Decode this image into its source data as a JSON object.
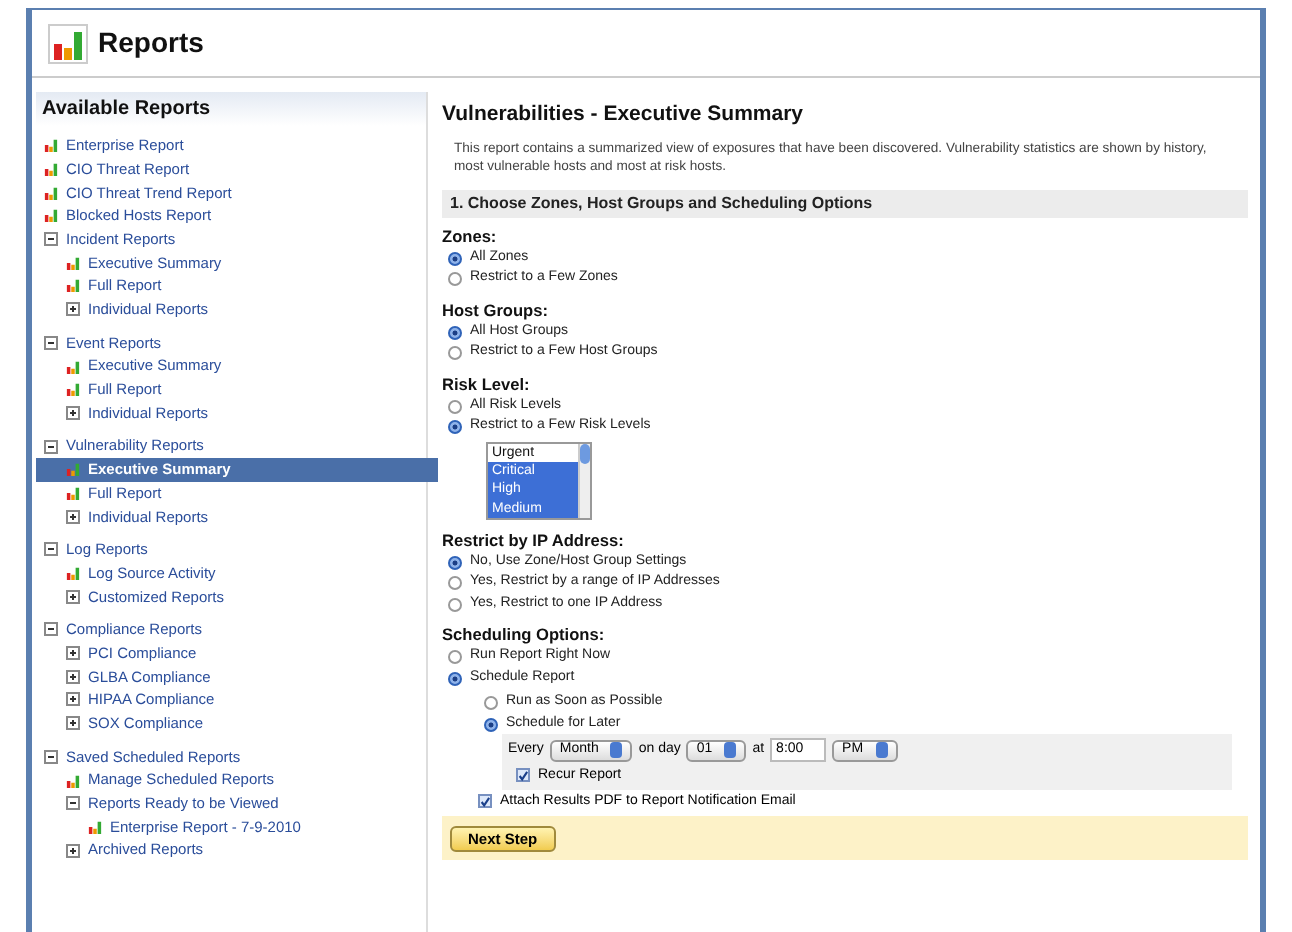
{
  "header": {
    "title": "Reports"
  },
  "sidebar": {
    "title": "Available Reports",
    "items": [
      {
        "label": "Enterprise Report",
        "kind": "report",
        "selected": false
      },
      {
        "label": "CIO Threat Report",
        "kind": "report",
        "selected": false
      },
      {
        "label": "CIO Threat Trend Report",
        "kind": "report",
        "selected": false
      },
      {
        "label": "Blocked Hosts Report",
        "kind": "report",
        "selected": false
      },
      {
        "label": "Incident Reports",
        "kind": "folder",
        "expanded": true,
        "selected": false,
        "children": [
          {
            "label": "Executive Summary",
            "kind": "report",
            "selected": false
          },
          {
            "label": "Full Report",
            "kind": "report",
            "selected": false
          },
          {
            "label": "Individual Reports",
            "kind": "folder",
            "expanded": false,
            "selected": false
          }
        ]
      },
      {
        "label": "Event Reports",
        "kind": "folder",
        "expanded": true,
        "selected": false,
        "children": [
          {
            "label": "Executive Summary",
            "kind": "report",
            "selected": false
          },
          {
            "label": "Full Report",
            "kind": "report",
            "selected": false
          },
          {
            "label": "Individual Reports",
            "kind": "folder",
            "expanded": false,
            "selected": false
          }
        ]
      },
      {
        "label": "Vulnerability Reports",
        "kind": "folder",
        "expanded": true,
        "selected": false,
        "children": [
          {
            "label": "Executive Summary",
            "kind": "report",
            "selected": true
          },
          {
            "label": "Full Report",
            "kind": "report",
            "selected": false
          },
          {
            "label": "Individual Reports",
            "kind": "folder",
            "expanded": false,
            "selected": false
          }
        ]
      },
      {
        "label": "Log Reports",
        "kind": "folder",
        "expanded": true,
        "selected": false,
        "children": [
          {
            "label": "Log Source Activity",
            "kind": "report",
            "selected": false
          },
          {
            "label": "Customized Reports",
            "kind": "folder",
            "expanded": false,
            "selected": false
          }
        ]
      },
      {
        "label": "Compliance Reports",
        "kind": "folder",
        "expanded": true,
        "selected": false,
        "children": [
          {
            "label": "PCI Compliance",
            "kind": "folder",
            "expanded": false,
            "selected": false
          },
          {
            "label": "GLBA Compliance",
            "kind": "folder",
            "expanded": false,
            "selected": false
          },
          {
            "label": "HIPAA Compliance",
            "kind": "folder",
            "expanded": false,
            "selected": false
          },
          {
            "label": "SOX Compliance",
            "kind": "folder",
            "expanded": false,
            "selected": false
          }
        ]
      },
      {
        "label": "Saved Scheduled Reports",
        "kind": "folder",
        "expanded": true,
        "selected": false,
        "children": [
          {
            "label": "Manage Scheduled Reports",
            "kind": "report",
            "selected": false
          },
          {
            "label": "Reports Ready to be Viewed",
            "kind": "folder",
            "expanded": true,
            "selected": false,
            "children": [
              {
                "label": "Enterprise Report - 7-9-2010",
                "kind": "report",
                "selected": false
              }
            ]
          },
          {
            "label": "Archived Reports",
            "kind": "folder",
            "expanded": false,
            "selected": false
          }
        ]
      }
    ]
  },
  "main": {
    "title": "Vulnerabilities - Executive Summary",
    "description": "This report contains a summarized view of exposures that have been discovered. Vulnerability statistics are shown by history, most vulnerable hosts and most at risk hosts.",
    "section_title": "1. Choose Zones, Host Groups and Scheduling Options",
    "groups": [
      {
        "label": "Zones:",
        "options": [
          {
            "label": "All Zones",
            "selected": true
          },
          {
            "label": "Restrict to a Few Zones",
            "selected": false
          }
        ]
      },
      {
        "label": "Host Groups:",
        "options": [
          {
            "label": "All Host Groups",
            "selected": true
          },
          {
            "label": "Restrict to a Few Host Groups",
            "selected": false
          }
        ]
      },
      {
        "label": "Risk Level:",
        "options": [
          {
            "label": "All Risk Levels",
            "selected": false
          },
          {
            "label": "Restrict to a Few Risk Levels",
            "selected": true
          }
        ],
        "listbox": [
          {
            "label": "Urgent",
            "selected": false
          },
          {
            "label": "Critical",
            "selected": true
          },
          {
            "label": "High",
            "selected": true
          },
          {
            "label": "Medium",
            "selected": true
          }
        ]
      },
      {
        "label": "Restrict by IP Address:",
        "options": [
          {
            "label": "No, Use Zone/Host Group Settings",
            "selected": true
          },
          {
            "label": "Yes, Restrict by a range of IP Addresses",
            "selected": false
          },
          {
            "label": "Yes, Restrict to one IP Address",
            "selected": false
          }
        ]
      },
      {
        "label": "Scheduling Options:",
        "options": [
          {
            "label": "Run Report Right Now",
            "selected": false
          },
          {
            "label": "Schedule Report",
            "selected": true
          }
        ]
      }
    ],
    "schedule": {
      "options": [
        {
          "label": "Run as Soon as Possible",
          "selected": false
        },
        {
          "label": "Schedule for Later",
          "selected": true
        }
      ],
      "every_label": "Every",
      "frequency": "Month",
      "on_day_label": "on day",
      "day": "01",
      "at_label": "at",
      "time": "8:00",
      "ampm": "PM",
      "recur": {
        "label": "Recur Report",
        "checked": true
      },
      "attach": {
        "label": "Attach Results PDF to Report Notification Email",
        "checked": true
      }
    },
    "button": "Next Step"
  }
}
